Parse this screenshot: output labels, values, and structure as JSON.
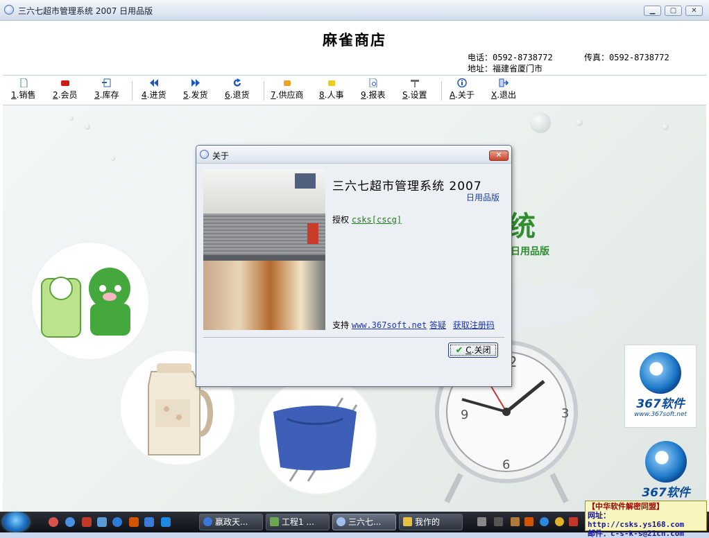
{
  "window": {
    "title": "三六七超市管理系统 2007 日用品版",
    "minimize_glyph": "▁",
    "maximize_glyph": "▢",
    "close_glyph": "✕"
  },
  "header": {
    "store_name": "麻雀商店",
    "phone": "电话：0592-8738772",
    "fax": "传真：0592-8738772",
    "address": "地址：福建省厦门市"
  },
  "toolbar": {
    "items": [
      {
        "key": "1",
        "label": ".销售",
        "icon": "document-icon",
        "color": "#5a7fb5"
      },
      {
        "key": "2",
        "label": ".会员",
        "icon": "member-card-icon",
        "color": "#d01818"
      },
      {
        "key": "3",
        "label": ".库存",
        "icon": "inventory-icon",
        "color": "#2a5fa8"
      },
      {
        "key": "4",
        "label": ".进货",
        "icon": "arrow-left-icon",
        "color": "#1f58c4"
      },
      {
        "key": "5",
        "label": ".发货",
        "icon": "arrow-right-icon",
        "color": "#1f58c4"
      },
      {
        "key": "6",
        "label": ".退货",
        "icon": "return-icon",
        "color": "#1f58c4"
      },
      {
        "key": "7",
        "label": ".供应商",
        "icon": "supplier-icon",
        "color": "#f0a020"
      },
      {
        "key": "8",
        "label": ".人事",
        "icon": "personnel-icon",
        "color": "#e8d020"
      },
      {
        "key": "9",
        "label": ".报表",
        "icon": "report-icon",
        "color": "#5a7fb5"
      },
      {
        "key": "S",
        "label": ".设置",
        "icon": "settings-tools-icon",
        "color": "#6a6a6a"
      },
      {
        "key": "A",
        "label": ".关于",
        "icon": "info-icon",
        "color": "#1f58c4"
      },
      {
        "key": "X",
        "label": ".退出",
        "icon": "exit-icon",
        "color": "#1f58c4"
      }
    ]
  },
  "background": {
    "title_fragment": "统",
    "edition_text": "日用品版",
    "logo_brand": "367软件",
    "logo_site": "www.367soft.net",
    "logo_brand_2": "367软件"
  },
  "dialog": {
    "title": "关于",
    "close_glyph": "✕",
    "app_name": "三六七超市管理系统 2007",
    "edition": "日用品版",
    "license_label": "授权",
    "license_value": "csks[cscg]",
    "support_label": "支持",
    "support_url": "www.367soft.net",
    "support_faq": "答疑",
    "support_register": "获取注册码",
    "close_key": "C",
    "close_label": ".关闭"
  },
  "taskbar": {
    "tasks": [
      {
        "label": "嬴政天...",
        "icon_color": "#3a78d8"
      },
      {
        "label": "工程1 ...",
        "icon_color": "#6aa84f"
      },
      {
        "label": "三六七...",
        "icon_color": "#9fc0ee",
        "active": true
      },
      {
        "label": "我作的",
        "icon_color": "#e8c040"
      }
    ]
  },
  "banner": {
    "line1": "【中华软件解密同盟】",
    "line2": "网址：http://csks.ys168.com",
    "line3": "邮件：c-s-k-s@21cn.com"
  }
}
